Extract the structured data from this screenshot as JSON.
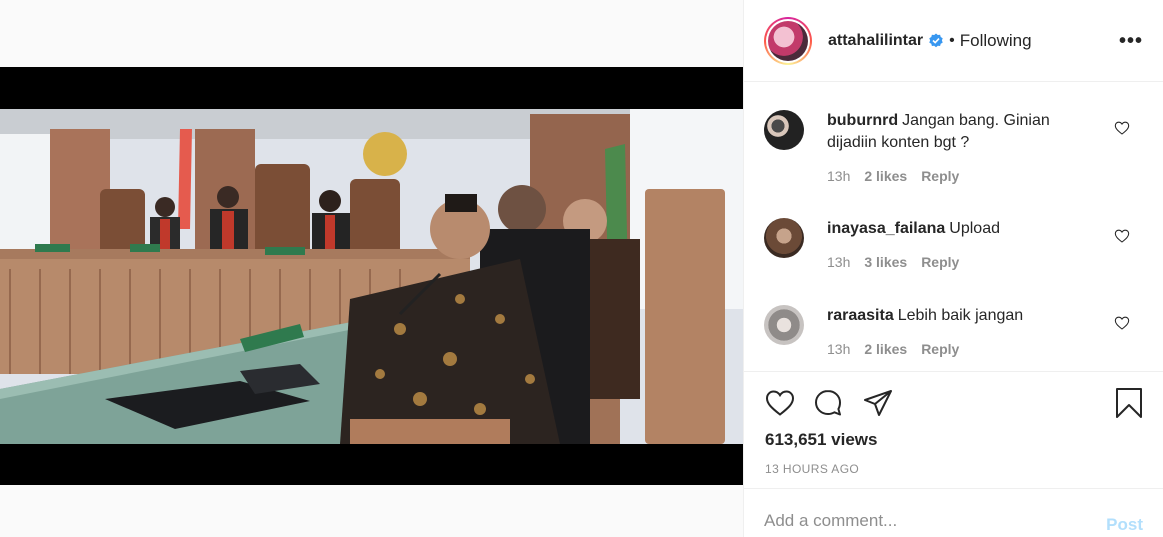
{
  "post": {
    "username": "attahalilintar",
    "verified": true,
    "follow_status": "Following",
    "more_label": "•••"
  },
  "comments": [
    {
      "username": "buburnrd",
      "text": "Jangan bang. Ginian dijadiin konten bgt ?",
      "time": "13h",
      "likes": "2 likes",
      "reply": "Reply"
    },
    {
      "username": "inayasa_failana",
      "text": "Upload",
      "time": "13h",
      "likes": "3 likes",
      "reply": "Reply"
    },
    {
      "username": "raraasita",
      "text": "Lebih baik jangan",
      "time": "13h",
      "likes": "2 likes",
      "reply": "Reply"
    }
  ],
  "stats": {
    "views": "613,651 views",
    "timestamp": "13 HOURS AGO"
  },
  "add_comment": {
    "placeholder": "Add a comment...",
    "post_label": "Post"
  },
  "colors": {
    "verified_blue": "#3897f0",
    "post_button_disabled": "#b2dffc",
    "meta_gray": "#8e8e8e"
  },
  "icons": [
    "heart-icon",
    "comment-icon",
    "share-icon",
    "bookmark-icon",
    "more-options-icon",
    "verified-icon"
  ]
}
